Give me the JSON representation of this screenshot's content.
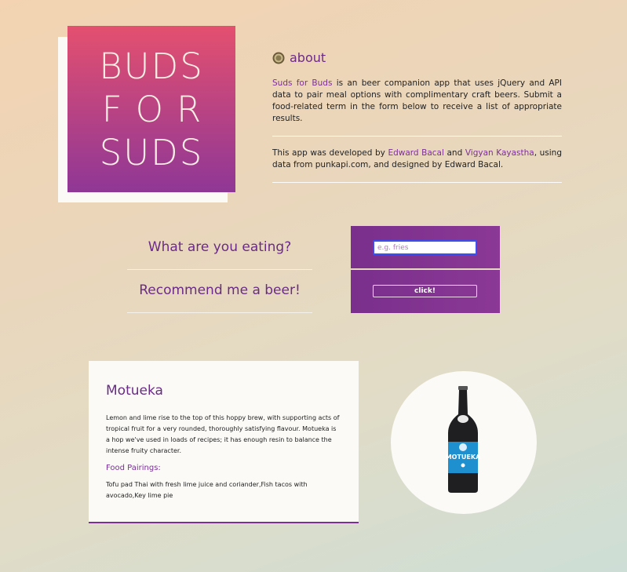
{
  "logo": {
    "line1": "BUDS",
    "line2": "FOR",
    "line3": "SUDS"
  },
  "about": {
    "heading": "about",
    "p1_link": "Suds for Buds",
    "p1_text": " is an beer companion app that uses jQuery and API data to pair meal options with complimentary craft beers. Submit a food-related term in the form below to receive a list of appropriate results.",
    "p2_prefix": "This app was developed by ",
    "dev1": "Edward Bacal",
    "p2_and": " and ",
    "dev2": "Vigyan Kayastha",
    "p2_suffix": ", using data from punkapi.com, and designed by Edward Bacal."
  },
  "form": {
    "question_label": "What are you eating?",
    "input_placeholder": "e.g. fries",
    "recommend_label": "Recommend me a beer!",
    "button_label": "click!"
  },
  "result": {
    "beer_name": "Motueka",
    "description": "Lemon and lime rise to the top of this hoppy brew, with supporting acts of tropical fruit for a very rounded, thoroughly satisfying flavour. Motueka is a hop we've used in loads of recipes; it has enough resin to balance the intense fruity character.",
    "pairings_heading": "Food Pairings:",
    "pairings": "Tofu pad Thai with fresh lime juice and coriander,Fish tacos with avocado,Key lime pie",
    "label_text": "MOTUEKA"
  },
  "colors": {
    "accent": "#7b2f97",
    "logo_top": "#e4506f",
    "logo_bottom": "#8f3796"
  },
  "icons": {
    "about": "bottle-cap-icon",
    "result_image": "beer-bottle-image"
  }
}
